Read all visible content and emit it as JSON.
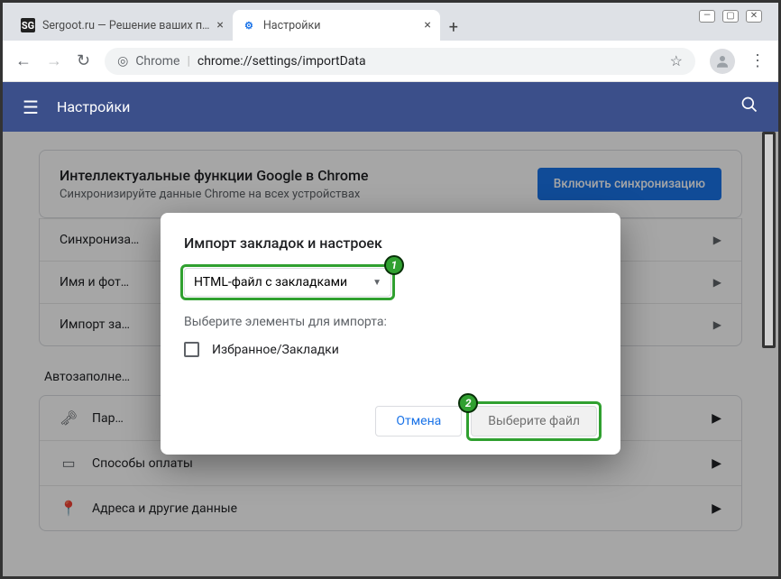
{
  "window": {
    "tabs": [
      {
        "favicon_text": "SG",
        "title": "Sergoot.ru — Решение ваших п…",
        "active": false
      },
      {
        "favicon_text": "⚙",
        "title": "Настройки",
        "active": true
      }
    ],
    "address": {
      "prefix": "Chrome",
      "divider": "|",
      "path": "chrome://settings/importData"
    }
  },
  "app_header": {
    "title": "Настройки"
  },
  "sync_card": {
    "heading": "Интеллектуальные функции Google в Chrome",
    "sub": "Синхронизируйте данные Chrome на всех устройствах",
    "button": "Включить синхронизацию"
  },
  "settings_rows": {
    "r0": "Синхрониза…",
    "r1": "Имя и фот…",
    "r2": "Импорт за…"
  },
  "section_autofill": "Автозаполне…",
  "autofill_rows": {
    "r0": "Пар…",
    "r1": "Способы оплаты",
    "r2": "Адреса и другие данные"
  },
  "modal": {
    "title": "Импорт закладок и настроек",
    "dropdown_value": "HTML-файл с закладками",
    "hint": "Выберите элементы для импорта:",
    "checkbox_label": "Избранное/Закладки",
    "cancel": "Отмена",
    "choose_file": "Выберите файл",
    "badge1": "1",
    "badge2": "2"
  }
}
